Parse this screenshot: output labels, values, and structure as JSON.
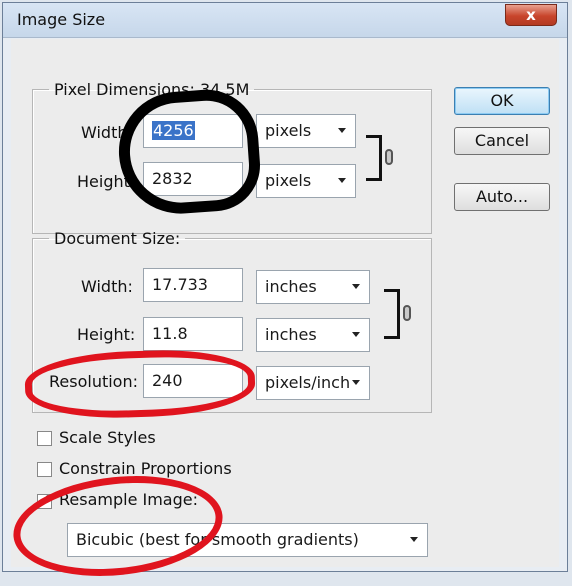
{
  "window": {
    "title": "Image Size",
    "close_glyph": "x"
  },
  "pixel_dimensions": {
    "legend": "Pixel Dimensions: 34.5M",
    "width_label": "Width:",
    "width_value": "4256",
    "height_label": "Height:",
    "height_value": "2832",
    "width_unit": "pixels",
    "height_unit": "pixels"
  },
  "document_size": {
    "legend": "Document Size:",
    "width_label": "Width:",
    "width_value": "17.733",
    "width_unit": "inches",
    "height_label": "Height:",
    "height_value": "11.8",
    "height_unit": "inches",
    "resolution_label": "Resolution:",
    "resolution_value": "240",
    "resolution_unit": "pixels/inch"
  },
  "options": {
    "scale_styles": {
      "label": "Scale Styles",
      "checked": false
    },
    "constrain_proportions": {
      "label": "Constrain Proportions",
      "checked": false
    },
    "resample_image": {
      "label": "Resample Image:",
      "checked": true
    },
    "resample_method": "Bicubic (best for smooth gradients)"
  },
  "buttons": {
    "ok": "OK",
    "cancel": "Cancel",
    "auto": "Auto..."
  },
  "annotations": {
    "black_marker_color": "#000000",
    "red_marker_color": "#e0141e"
  }
}
